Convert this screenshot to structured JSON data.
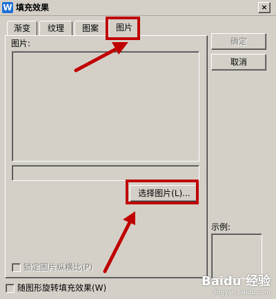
{
  "window": {
    "title": "填充效果",
    "app_icon_letter": "W",
    "close_glyph": "×"
  },
  "tabs": [
    {
      "label": "渐变",
      "active": false
    },
    {
      "label": "纹理",
      "active": false
    },
    {
      "label": "图案",
      "active": false
    },
    {
      "label": "图片",
      "active": true
    }
  ],
  "panel": {
    "picture_label": "图片:",
    "select_picture_button": "选择图片(L)...",
    "lock_aspect_checkbox": {
      "label": "锁定图片纵横比(P)",
      "checked": false,
      "enabled": false
    }
  },
  "side": {
    "ok_button": "确定",
    "ok_enabled": false,
    "cancel_button": "取消",
    "sample_label": "示例:"
  },
  "footer": {
    "rotate_checkbox": {
      "label": "随图形旋转填充效果(W)",
      "checked": false
    }
  },
  "annotations": {
    "highlight_color": "#c00000"
  },
  "watermark": {
    "logo": "Baidu 经验",
    "url": "jingyan.baidu.com"
  }
}
